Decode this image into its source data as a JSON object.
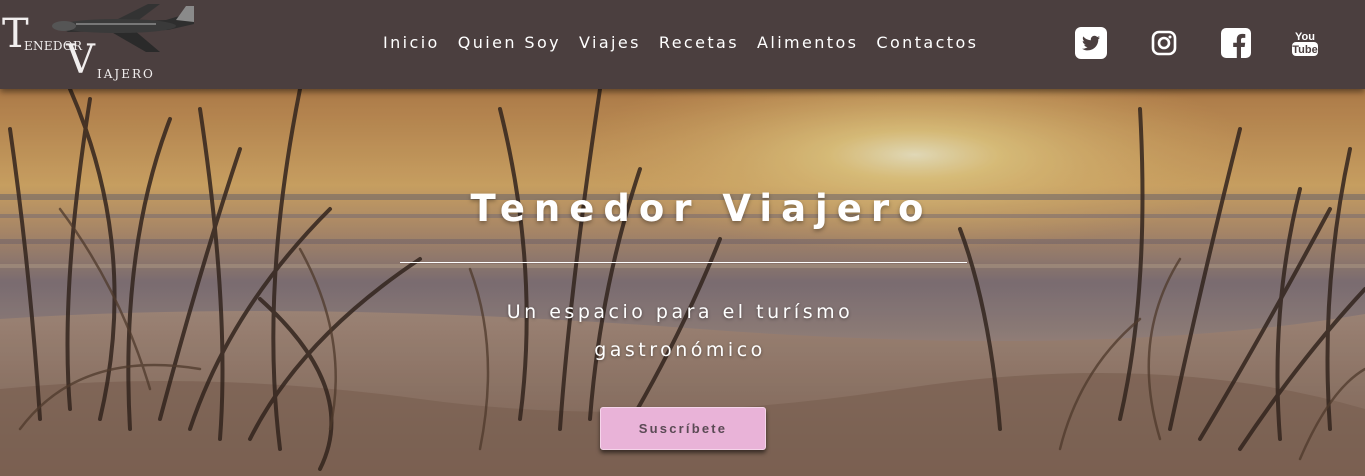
{
  "header": {
    "logo": {
      "first_initial": "T",
      "first_rest": "ENEDOR",
      "second_initial": "V",
      "second_rest": "IAJERO",
      "icon": "airplane-icon"
    },
    "nav": [
      {
        "label": "Inicio"
      },
      {
        "label": "Quien Soy"
      },
      {
        "label": "Viajes"
      },
      {
        "label": "Recetas"
      },
      {
        "label": "Alimentos"
      },
      {
        "label": "Contactos"
      }
    ],
    "social": [
      {
        "icon": "twitter-icon"
      },
      {
        "icon": "instagram-icon"
      },
      {
        "icon": "facebook-icon"
      },
      {
        "icon": "youtube-icon",
        "label_top": "You",
        "label_bottom": "Tube"
      }
    ]
  },
  "hero": {
    "title": "Tenedor Viajero",
    "subtitle": "Un espacio para el turísmo gastronómico",
    "button_label": "Suscríbete"
  },
  "colors": {
    "navbar": "#4b3f3f",
    "button": "#e9b3d8",
    "text": "#ffffff"
  }
}
